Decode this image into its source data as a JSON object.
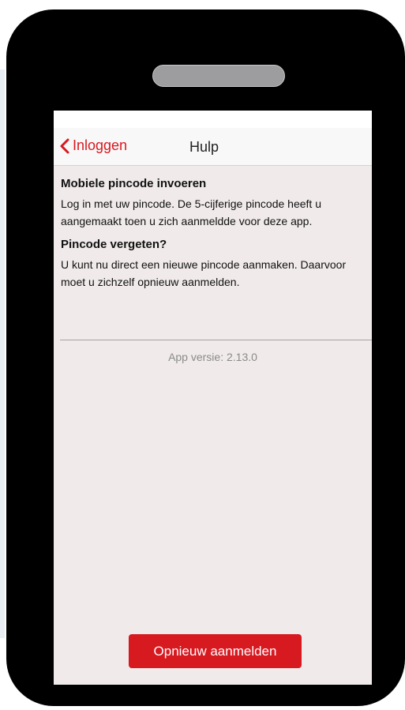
{
  "colors": {
    "accent": "#d71920",
    "background": "#f0eaea",
    "navbar": "#f8f8f8",
    "phone_frame": "#000000"
  },
  "nav": {
    "back_label": "Inloggen",
    "back_icon": "chevron-left-icon",
    "title": "Hulp"
  },
  "sections": [
    {
      "heading": "Mobiele pincode invoeren",
      "body": "Log in met uw pincode. De 5-cijferige pincode heeft u aangemaakt toen u zich aanmeldde voor deze app."
    },
    {
      "heading": "Pincode vergeten?",
      "body": "U kunt nu direct een nieuwe pincode aanmaken. Daarvoor moet u zichzelf opnieuw aanmelden."
    }
  ],
  "version_text": "App versie: 2.13.0",
  "register_button_label": "Opnieuw aanmelden"
}
